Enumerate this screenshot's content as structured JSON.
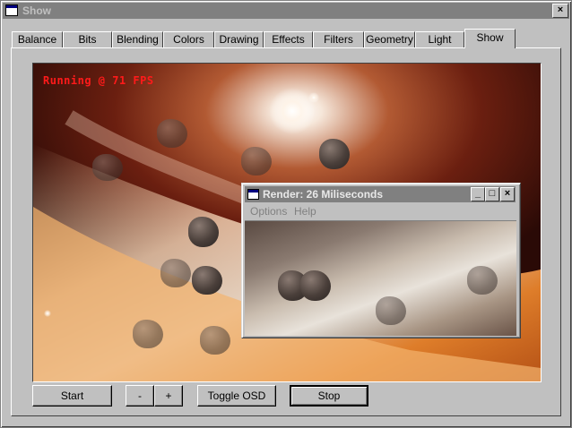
{
  "window": {
    "title": "Show",
    "close_glyph": "×"
  },
  "tabs": [
    {
      "label": "Balance"
    },
    {
      "label": "Bits"
    },
    {
      "label": "Blending"
    },
    {
      "label": "Colors"
    },
    {
      "label": "Drawing"
    },
    {
      "label": "Effects"
    },
    {
      "label": "Filters"
    },
    {
      "label": "Geometry"
    },
    {
      "label": "Light"
    },
    {
      "label": "Show"
    }
  ],
  "active_tab": "Show",
  "viewport": {
    "osd_text": "Running @ 71 FPS",
    "osd_color": "#ff1a1a"
  },
  "render_window": {
    "title": "Render: 26 Miliseconds",
    "minimize_glyph": "_",
    "maximize_glyph": "□",
    "close_glyph": "×",
    "menu": [
      {
        "label": "Options"
      },
      {
        "label": "Help"
      }
    ]
  },
  "buttons": {
    "start": "Start",
    "minus": "-",
    "plus": "+",
    "toggle_osd": "Toggle OSD",
    "stop": "Stop"
  },
  "icons": {
    "app": "window-app-icon",
    "minimize": "minimize-icon",
    "maximize": "maximize-icon",
    "close": "close-icon"
  }
}
